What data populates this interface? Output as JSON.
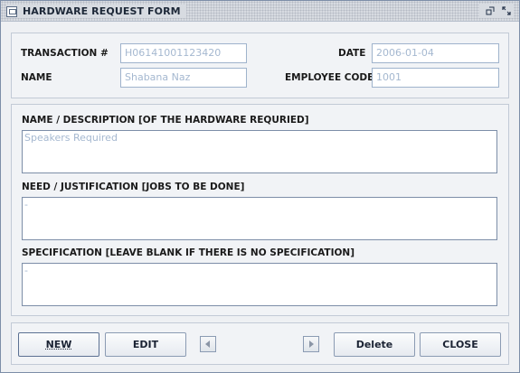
{
  "window": {
    "title": "HARDWARE REQUEST FORM"
  },
  "header": {
    "transaction_label": "TRANSACTION #",
    "transaction_value": "H06141001123420",
    "date_label": "DATE",
    "date_value": "2006-01-04",
    "name_label": "NAME",
    "name_value": "Shabana Naz",
    "employee_code_label": "EMPLOYEE CODE",
    "employee_code_value": "1001"
  },
  "details": {
    "description_label": "NAME / DESCRIPTION [OF THE HARDWARE REQURIED]",
    "description_value": "Speakers Required",
    "justification_label": "NEED / JUSTIFICATION [JOBS TO BE DONE]",
    "justification_value": "-",
    "specification_label": "SPECIFICATION [LEAVE BLANK IF THERE IS NO SPECIFICATION]",
    "specification_value": "-"
  },
  "toolbar": {
    "new_label": "NEW",
    "edit_label": "EDIT",
    "delete_label": "Delete",
    "close_label": "CLOSE"
  },
  "icons": {
    "app": "window-icon",
    "restore": "restore-icon",
    "maximize": "maximize-icon",
    "previous": "triangle-left-icon",
    "next": "triangle-right-icon"
  },
  "colors": {
    "value_text": "#a5b8d0",
    "border": "#7d8ea8"
  }
}
